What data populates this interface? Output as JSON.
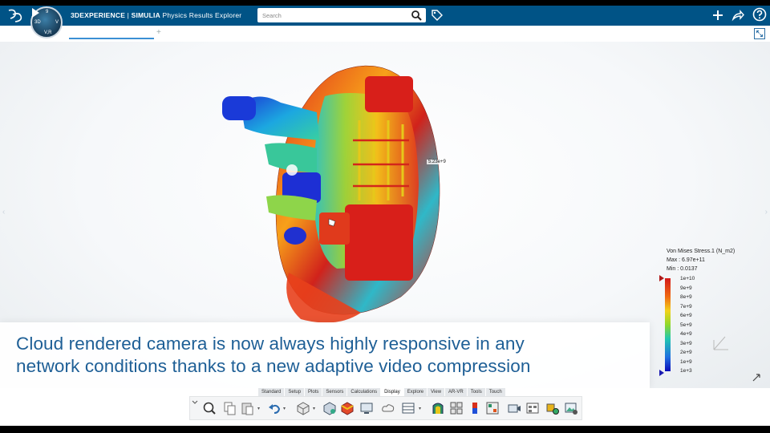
{
  "header": {
    "brand_bold": "3DEXPERIENCE",
    "brand_sep": " | ",
    "brand_product": "SIMULIA",
    "app_name": "Physics Results Explorer",
    "compass_left": "3D",
    "compass_top": "9",
    "compass_right": "V",
    "compass_bottom": "V,R",
    "search_placeholder": "Search"
  },
  "viewport": {
    "probe_label": "5.23e+9",
    "legend": {
      "title": "Von Mises Stress.1 (N_m2)",
      "max": "Max : 6.97e+11",
      "min": "Min : 0.0137",
      "ticks": [
        "1e+10",
        "9e+9",
        "8e+9",
        "7e+9",
        "6e+9",
        "5e+9",
        "4e+9",
        "3e+9",
        "2e+9",
        "1e+9",
        "1e+3"
      ],
      "colors": {
        "top": "#d31a1a",
        "bottom": "#0a0ab8"
      }
    }
  },
  "caption": {
    "line1": "Cloud rendered camera is now always highly responsive in any",
    "line2": "network conditions thanks to a new adaptive video compression",
    "color": "#1e5f96"
  },
  "toolbar": {
    "tabs": [
      "Standard",
      "Setup",
      "Plots",
      "Sensors",
      "Calculations",
      "Display",
      "Explore",
      "View",
      "AR-VR",
      "Tools",
      "Touch"
    ],
    "active_tab": "Display"
  }
}
